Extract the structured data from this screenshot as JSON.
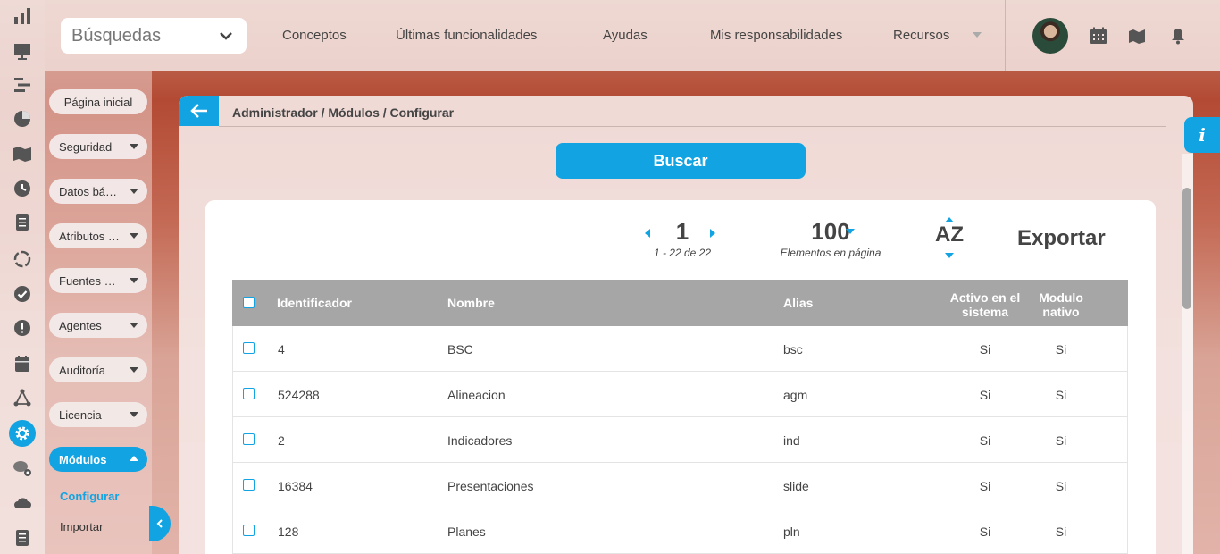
{
  "colors": {
    "accent": "#12a4e2",
    "header_gray": "#a6a6a6",
    "text": "#444444"
  },
  "topbar": {
    "search": {
      "label": "Búsquedas"
    },
    "nav": [
      "Conceptos",
      "Últimas funcionalidades",
      "Ayudas",
      "Mis responsabilidades",
      "Recursos"
    ]
  },
  "rail": {
    "icons": [
      "bar-chart-icon",
      "presentation-icon",
      "gantt-icon",
      "pie-chart-icon",
      "map-icon",
      "clock-icon",
      "document-icon",
      "cycle-icon",
      "check-circle-icon",
      "warning-icon",
      "calendar-icon",
      "network-icon",
      "gear-icon",
      "chat-gear-icon",
      "cloud-icon",
      "list-icon"
    ],
    "active": "gear-icon"
  },
  "sidebar": {
    "home": "Página inicial",
    "items": [
      "Seguridad",
      "Datos básicos",
      "Atributos de usuario",
      "Fuentes de datos",
      "Agentes",
      "Auditoría",
      "Licencia"
    ],
    "active_group": "Módulos",
    "sub_items": [
      "Configurar",
      "Importar"
    ],
    "active_sub": "Configurar"
  },
  "panel": {
    "breadcrumb": "Administrador / Módulos / Configurar",
    "search_button": "Buscar",
    "pager": {
      "page": "1",
      "range": "1 - 22 de 22"
    },
    "per_page": {
      "value": "100",
      "label": "Elementos en página"
    },
    "sort": "AZ",
    "export": "Exportar",
    "table": {
      "headers": {
        "id": "Identificador",
        "name": "Nombre",
        "alias": "Alias",
        "active_l1": "Activo en el",
        "active_l2": "sistema",
        "native_l1": "Modulo",
        "native_l2": "nativo"
      },
      "rows": [
        {
          "id": "4",
          "name": "BSC",
          "alias": "bsc",
          "active": "Si",
          "native": "Si"
        },
        {
          "id": "524288",
          "name": "Alineacion",
          "alias": "agm",
          "active": "Si",
          "native": "Si"
        },
        {
          "id": "2",
          "name": "Indicadores",
          "alias": "ind",
          "active": "Si",
          "native": "Si"
        },
        {
          "id": "16384",
          "name": "Presentaciones",
          "alias": "slide",
          "active": "Si",
          "native": "Si"
        },
        {
          "id": "128",
          "name": "Planes",
          "alias": "pln",
          "active": "Si",
          "native": "Si"
        }
      ]
    }
  },
  "info_tab": "i"
}
